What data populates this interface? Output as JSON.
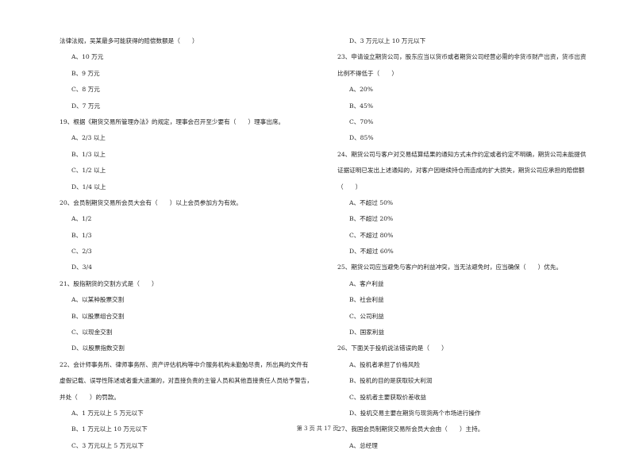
{
  "left_column": [
    {
      "type": "text",
      "text": "法律法规，吴某最多可能获得的赔偿数额是（　　）"
    },
    {
      "type": "option",
      "text": "A、10 万元"
    },
    {
      "type": "option",
      "text": "B、9 万元"
    },
    {
      "type": "option",
      "text": "C、8 万元"
    },
    {
      "type": "option",
      "text": "D、7 万元"
    },
    {
      "type": "question",
      "text": "19、根据《期货交易所管理办法》的规定，理事会召开至少要有（　　）理事出席。"
    },
    {
      "type": "option",
      "text": "A、2/3 以上"
    },
    {
      "type": "option",
      "text": "B、1/3 以上"
    },
    {
      "type": "option",
      "text": "C、1/2 以上"
    },
    {
      "type": "option",
      "text": "D、1/4 以上"
    },
    {
      "type": "question",
      "text": "20、会员制期货交易所会员大会有（　　）以上会员参加方为有效。"
    },
    {
      "type": "option",
      "text": "A、1/2"
    },
    {
      "type": "option",
      "text": "B、1/3"
    },
    {
      "type": "option",
      "text": "C、2/3"
    },
    {
      "type": "option",
      "text": "D、3/4"
    },
    {
      "type": "question",
      "text": "21、股指期货的交割方式是（　　）"
    },
    {
      "type": "option",
      "text": "A、以某种股票交割"
    },
    {
      "type": "option",
      "text": "B、以股票组合交割"
    },
    {
      "type": "option",
      "text": "C、以现金交割"
    },
    {
      "type": "option",
      "text": "D、以股票指数交割"
    },
    {
      "type": "question",
      "text": "22、会计师事务所、律师事务所、资产评估机构等中介服务机构未勤勉尽责，所出具的文件有"
    },
    {
      "type": "text",
      "text": "虚假记载、误导性陈述或者重大遗漏的，对直接负责的主管人员和其他直接责任人员给予警告，"
    },
    {
      "type": "text",
      "text": "并处（　　）的罚款。"
    },
    {
      "type": "option",
      "text": "A、1 万元以上 5 万元以下"
    },
    {
      "type": "option",
      "text": "B、1 万元以上 10 万元以下"
    },
    {
      "type": "option",
      "text": "C、3 万元以上 5 万元以下"
    }
  ],
  "right_column": [
    {
      "type": "option",
      "text": "D、3 万元以上 10 万元以下"
    },
    {
      "type": "question",
      "text": "23、申请设立期货公司，股东应当以货币或者期货公司经营必需的非货币财产出资，货币出资"
    },
    {
      "type": "text",
      "text": "比例不得低于（　　）"
    },
    {
      "type": "option",
      "text": "A、20%"
    },
    {
      "type": "option",
      "text": "B、45%"
    },
    {
      "type": "option",
      "text": "C、70%"
    },
    {
      "type": "option",
      "text": "D、85%"
    },
    {
      "type": "question",
      "text": "24、期货公司与客户对交易结算结果的通知方式未作约定或者约定不明确，期货公司未能提供"
    },
    {
      "type": "text",
      "text": "证据证明已发出上述通知的，对客户因继续持仓而造成的扩大损失，期货公司应承担的赔偿额"
    },
    {
      "type": "text",
      "text": "（　　）"
    },
    {
      "type": "option",
      "text": "A、不超过 50%"
    },
    {
      "type": "option",
      "text": "B、不超过 20%"
    },
    {
      "type": "option",
      "text": "C、不超过 80%"
    },
    {
      "type": "option",
      "text": "D、不超过 60%"
    },
    {
      "type": "question",
      "text": "25、期货公司应当避免与客户的利益冲突，当无法避免时，应当确保（　　）优先。"
    },
    {
      "type": "option",
      "text": "A、客户利益"
    },
    {
      "type": "option",
      "text": "B、社会利益"
    },
    {
      "type": "option",
      "text": "C、公司利益"
    },
    {
      "type": "option",
      "text": "D、国家利益"
    },
    {
      "type": "question",
      "text": "26、下面关于投机说法错误的是（　　）"
    },
    {
      "type": "option",
      "text": "A、投机者承担了价格风险"
    },
    {
      "type": "option",
      "text": "B、投机的目的是获取较大利润"
    },
    {
      "type": "option",
      "text": "C、投机者主要获取价差收益"
    },
    {
      "type": "option",
      "text": "D、投机交易主要在期货与现货两个市场进行操作"
    },
    {
      "type": "question",
      "text": "27、我国会员制期货交易所会员大会由（　　）主持。"
    },
    {
      "type": "option",
      "text": "A、总经理"
    }
  ],
  "footer": {
    "page_label": "第 3 页 共 17 页"
  }
}
